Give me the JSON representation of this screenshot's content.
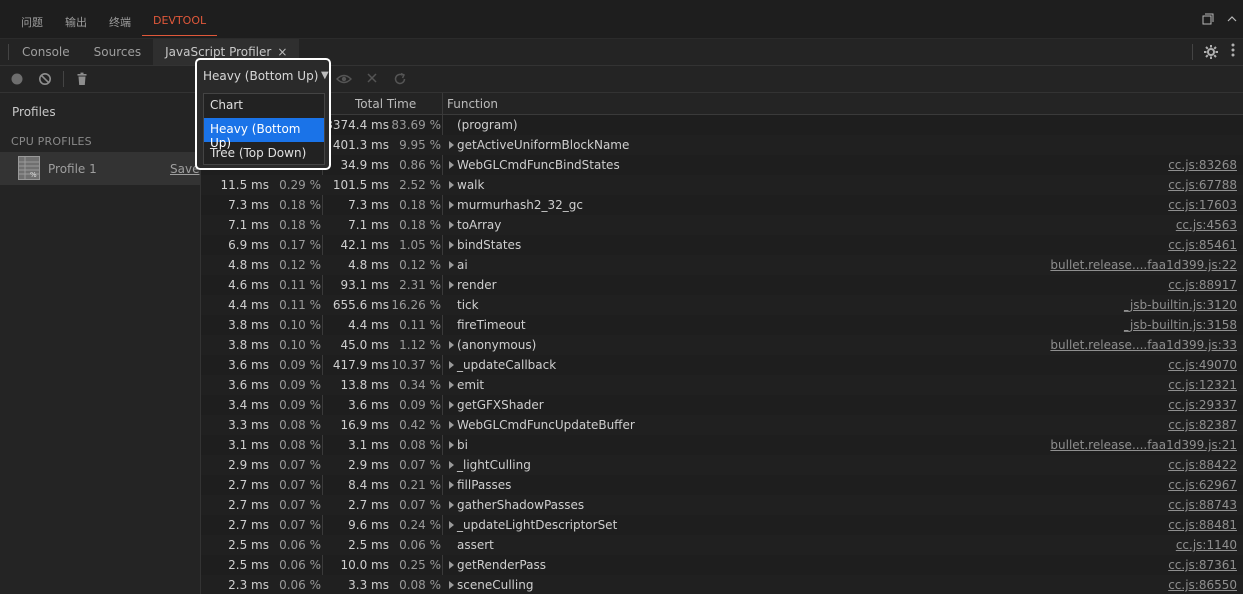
{
  "panel_tabs": [
    "问题",
    "输出",
    "终端",
    "DEVTOOL"
  ],
  "devtools_tabs": {
    "console": "Console",
    "sources": "Sources",
    "profiler": "JavaScript Profiler",
    "close": "×"
  },
  "view_select": {
    "value": "Heavy (Bottom Up)",
    "options": [
      "Chart",
      "Heavy (Bottom Up)",
      "Tree (Top Down)"
    ]
  },
  "sidebar": {
    "title": "Profiles",
    "section": "CPU PROFILES",
    "profile_name": "Profile 1",
    "save_label": "Save"
  },
  "columns": {
    "total": "Total Time",
    "function": "Function"
  },
  "rows": [
    {
      "self": "",
      "self_pct": "",
      "total": "3374.4 ms",
      "total_pct": "83.69 %",
      "func": "(program)",
      "src": "",
      "arrow": false
    },
    {
      "self": "",
      "self_pct": "",
      "total": "401.3 ms",
      "total_pct": "9.95 %",
      "func": "getActiveUniformBlockName",
      "src": "",
      "arrow": true
    },
    {
      "self": "33.7 ms",
      "self_pct": "0.84 %",
      "total": "34.9 ms",
      "total_pct": "0.86 %",
      "func": "WebGLCmdFuncBindStates",
      "src": "cc.js:83268",
      "arrow": true
    },
    {
      "self": "11.5 ms",
      "self_pct": "0.29 %",
      "total": "101.5 ms",
      "total_pct": "2.52 %",
      "func": "walk",
      "src": "cc.js:67788",
      "arrow": true
    },
    {
      "self": "7.3 ms",
      "self_pct": "0.18 %",
      "total": "7.3 ms",
      "total_pct": "0.18 %",
      "func": "murmurhash2_32_gc",
      "src": "cc.js:17603",
      "arrow": true
    },
    {
      "self": "7.1 ms",
      "self_pct": "0.18 %",
      "total": "7.1 ms",
      "total_pct": "0.18 %",
      "func": "toArray",
      "src": "cc.js:4563",
      "arrow": true
    },
    {
      "self": "6.9 ms",
      "self_pct": "0.17 %",
      "total": "42.1 ms",
      "total_pct": "1.05 %",
      "func": "bindStates",
      "src": "cc.js:85461",
      "arrow": true
    },
    {
      "self": "4.8 ms",
      "self_pct": "0.12 %",
      "total": "4.8 ms",
      "total_pct": "0.12 %",
      "func": "ai",
      "src": "bullet.release....faa1d399.js:22",
      "arrow": true
    },
    {
      "self": "4.6 ms",
      "self_pct": "0.11 %",
      "total": "93.1 ms",
      "total_pct": "2.31 %",
      "func": "render",
      "src": "cc.js:88917",
      "arrow": true
    },
    {
      "self": "4.4 ms",
      "self_pct": "0.11 %",
      "total": "655.6 ms",
      "total_pct": "16.26 %",
      "func": "tick",
      "src": "_jsb-builtin.js:3120",
      "arrow": false
    },
    {
      "self": "3.8 ms",
      "self_pct": "0.10 %",
      "total": "4.4 ms",
      "total_pct": "0.11 %",
      "func": "fireTimeout",
      "src": "_jsb-builtin.js:3158",
      "arrow": false
    },
    {
      "self": "3.8 ms",
      "self_pct": "0.10 %",
      "total": "45.0 ms",
      "total_pct": "1.12 %",
      "func": "(anonymous)",
      "src": "bullet.release....faa1d399.js:33",
      "arrow": true
    },
    {
      "self": "3.6 ms",
      "self_pct": "0.09 %",
      "total": "417.9 ms",
      "total_pct": "10.37 %",
      "func": "_updateCallback",
      "src": "cc.js:49070",
      "arrow": true
    },
    {
      "self": "3.6 ms",
      "self_pct": "0.09 %",
      "total": "13.8 ms",
      "total_pct": "0.34 %",
      "func": "emit",
      "src": "cc.js:12321",
      "arrow": true
    },
    {
      "self": "3.4 ms",
      "self_pct": "0.09 %",
      "total": "3.6 ms",
      "total_pct": "0.09 %",
      "func": "getGFXShader",
      "src": "cc.js:29337",
      "arrow": true
    },
    {
      "self": "3.3 ms",
      "self_pct": "0.08 %",
      "total": "16.9 ms",
      "total_pct": "0.42 %",
      "func": "WebGLCmdFuncUpdateBuffer",
      "src": "cc.js:82387",
      "arrow": true
    },
    {
      "self": "3.1 ms",
      "self_pct": "0.08 %",
      "total": "3.1 ms",
      "total_pct": "0.08 %",
      "func": "bi",
      "src": "bullet.release....faa1d399.js:21",
      "arrow": true
    },
    {
      "self": "2.9 ms",
      "self_pct": "0.07 %",
      "total": "2.9 ms",
      "total_pct": "0.07 %",
      "func": "_lightCulling",
      "src": "cc.js:88422",
      "arrow": true
    },
    {
      "self": "2.7 ms",
      "self_pct": "0.07 %",
      "total": "8.4 ms",
      "total_pct": "0.21 %",
      "func": "fillPasses",
      "src": "cc.js:62967",
      "arrow": true
    },
    {
      "self": "2.7 ms",
      "self_pct": "0.07 %",
      "total": "2.7 ms",
      "total_pct": "0.07 %",
      "func": "gatherShadowPasses",
      "src": "cc.js:88743",
      "arrow": true
    },
    {
      "self": "2.7 ms",
      "self_pct": "0.07 %",
      "total": "9.6 ms",
      "total_pct": "0.24 %",
      "func": "_updateLightDescriptorSet",
      "src": "cc.js:88481",
      "arrow": true
    },
    {
      "self": "2.5 ms",
      "self_pct": "0.06 %",
      "total": "2.5 ms",
      "total_pct": "0.06 %",
      "func": "assert",
      "src": "cc.js:1140",
      "arrow": false
    },
    {
      "self": "2.5 ms",
      "self_pct": "0.06 %",
      "total": "10.0 ms",
      "total_pct": "0.25 %",
      "func": "getRenderPass",
      "src": "cc.js:87361",
      "arrow": true
    },
    {
      "self": "2.3 ms",
      "self_pct": "0.06 %",
      "total": "3.3 ms",
      "total_pct": "0.08 %",
      "func": "sceneCulling",
      "src": "cc.js:86550",
      "arrow": true
    }
  ],
  "colors": {
    "accent": "#e0583a",
    "selection": "#1a73e8",
    "background": "#1e1e1e"
  }
}
